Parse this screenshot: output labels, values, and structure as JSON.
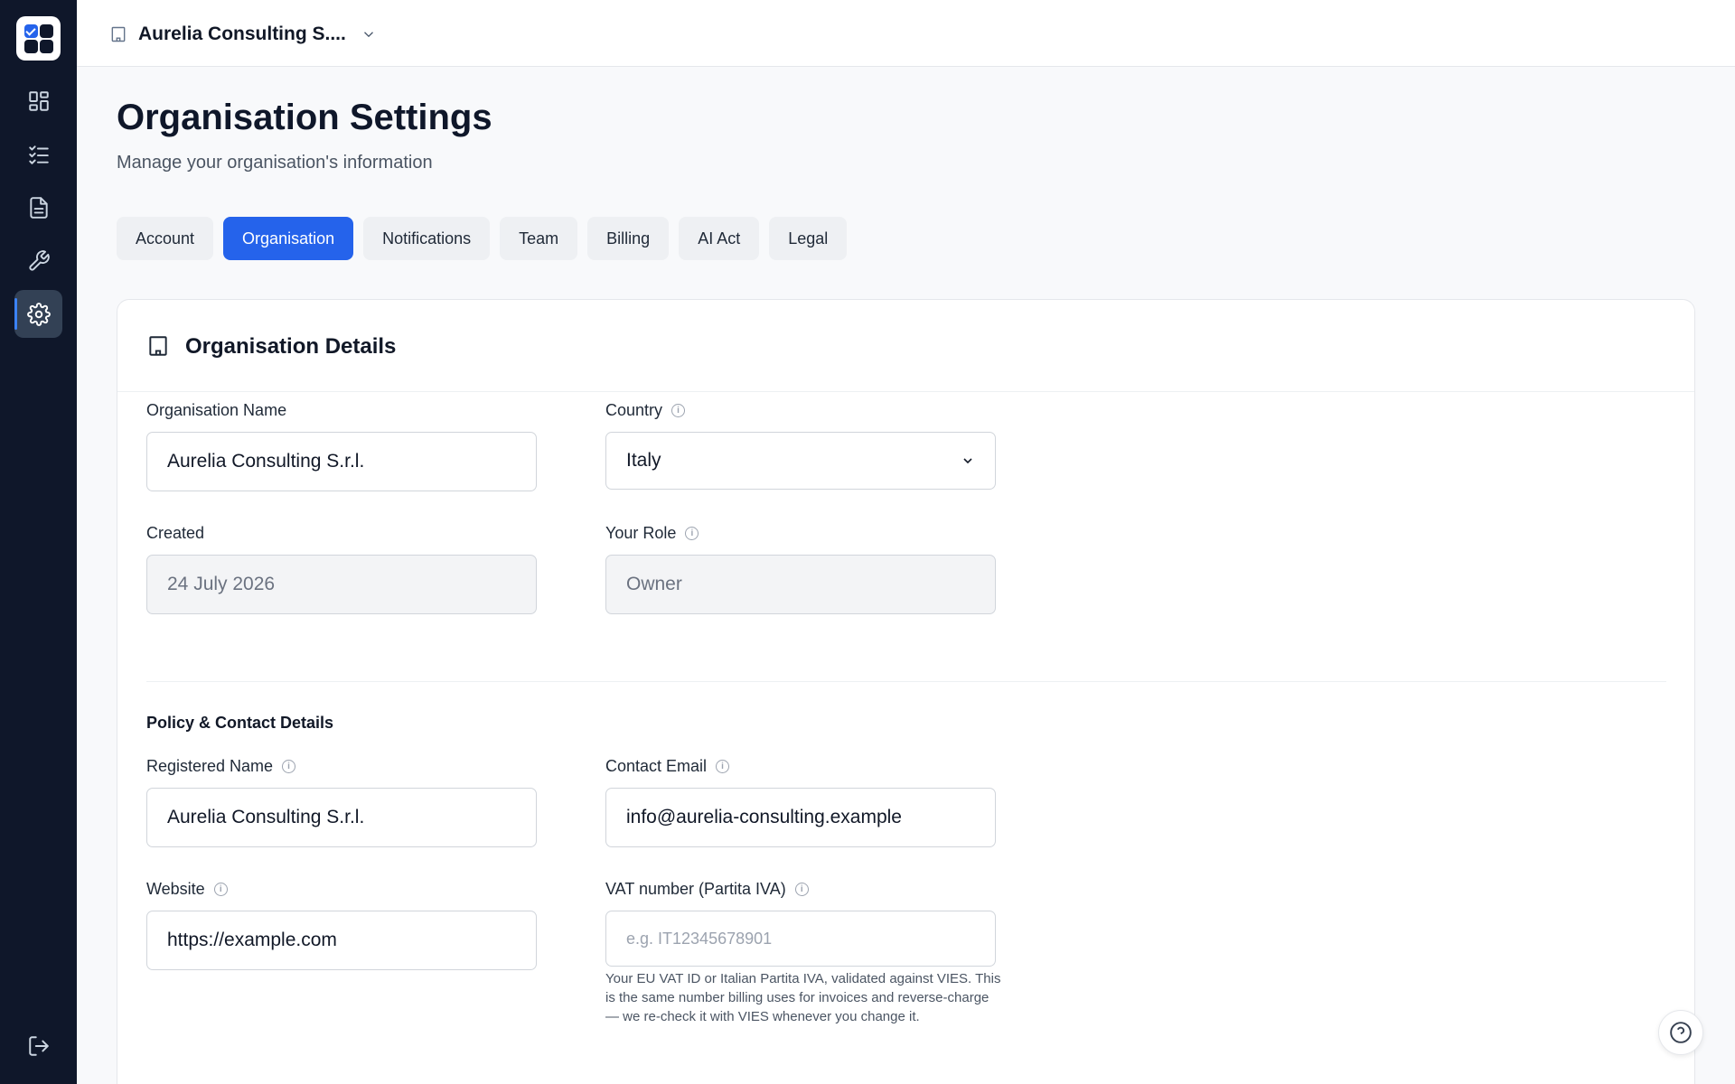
{
  "topbar": {
    "org_name": "Aurelia Consulting S...."
  },
  "page": {
    "title": "Organisation Settings",
    "subtitle": "Manage your organisation's information"
  },
  "tabs": [
    {
      "label": "Account",
      "active": false
    },
    {
      "label": "Organisation",
      "active": true
    },
    {
      "label": "Notifications",
      "active": false
    },
    {
      "label": "Team",
      "active": false
    },
    {
      "label": "Billing",
      "active": false
    },
    {
      "label": "AI Act",
      "active": false
    },
    {
      "label": "Legal",
      "active": false
    }
  ],
  "card": {
    "title": "Organisation Details",
    "fields": {
      "org_name": {
        "label": "Organisation Name",
        "value": "Aurelia Consulting S.r.l."
      },
      "country": {
        "label": "Country",
        "value": "Italy"
      },
      "created": {
        "label": "Created",
        "value": "24 July 2026"
      },
      "role": {
        "label": "Your Role",
        "value": "Owner"
      }
    },
    "policy_section": {
      "title": "Policy & Contact Details",
      "registered_name": {
        "label": "Registered Name",
        "value": "Aurelia Consulting S.r.l."
      },
      "contact_email": {
        "label": "Contact Email",
        "value": "info@aurelia-consulting.example"
      },
      "website": {
        "label": "Website",
        "value": "https://example.com"
      },
      "vat": {
        "label": "VAT number (Partita IVA)",
        "placeholder": "e.g. IT12345678901",
        "help": "Your EU VAT ID or Italian Partita IVA, validated against VIES. This is the same number billing uses for invoices and reverse-charge — we re-check it with VIES whenever you change it."
      }
    }
  },
  "icons": {
    "nav": [
      "dashboard-icon",
      "checklist-icon",
      "document-icon",
      "wrench-icon",
      "gear-icon",
      "logout-icon"
    ],
    "help": "help-circle-icon"
  },
  "colors": {
    "sidebar": "#0f172a",
    "accent": "#2563eb"
  }
}
